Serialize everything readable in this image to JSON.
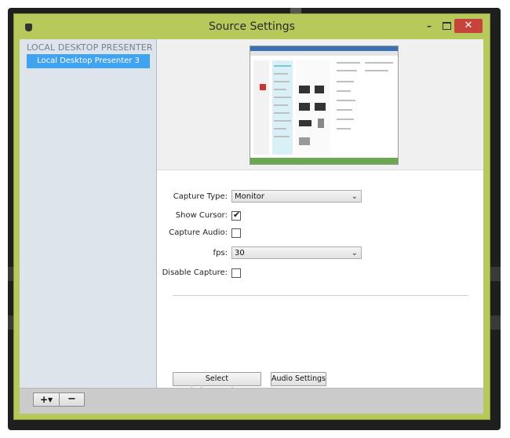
{
  "window": {
    "title": "Source Settings",
    "minimize_glyph": "–",
    "close_glyph": "✕"
  },
  "sidebar": {
    "header": "LOCAL DESKTOP PRESENTER",
    "items": [
      {
        "label": "Local Desktop Presenter 3",
        "selected": true
      }
    ]
  },
  "settings": {
    "capture_type": {
      "label": "Capture Type:",
      "value": "Monitor"
    },
    "show_cursor": {
      "label": "Show Cursor:",
      "checked": true
    },
    "capture_audio": {
      "label": "Capture Audio:",
      "checked": false
    },
    "fps": {
      "label": "fps:",
      "value": "30"
    },
    "disable_capture": {
      "label": "Disable Capture:",
      "checked": false
    }
  },
  "buttons": {
    "select_window": "Select Window/Monitor...",
    "audio_settings": "Audio Settings"
  },
  "toolbar": {
    "add_glyph": "+▾",
    "remove_glyph": "−"
  },
  "colors": {
    "window_accent": "#b6c95a",
    "selection": "#3fa3f0",
    "close_button": "#c7443a"
  }
}
